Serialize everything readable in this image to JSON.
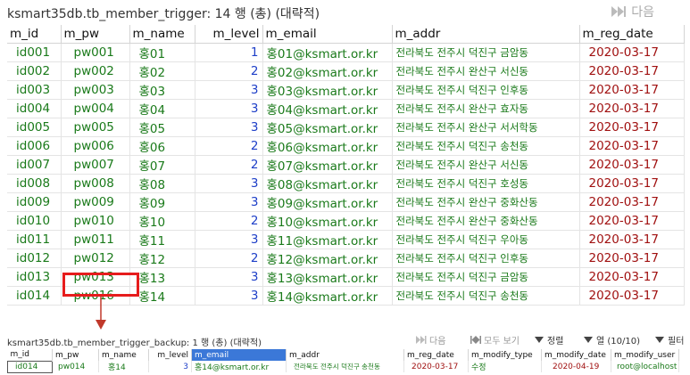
{
  "top": {
    "title": "ksmart35db.tb_member_trigger: 14 행 (총) (대략적)",
    "next_label": "다음",
    "columns": [
      "m_id",
      "m_pw",
      "m_name",
      "m_level",
      "m_email",
      "m_addr",
      "m_reg_date"
    ],
    "rows": [
      [
        "id001",
        "pw001",
        "홍01",
        "1",
        "홍01@ksmart.or.kr",
        "전라북도 전주시 덕진구 금암동",
        "2020-03-17"
      ],
      [
        "id002",
        "pw002",
        "홍02",
        "2",
        "홍02@ksmart.or.kr",
        "전라북도 전주시 완산구 서신동",
        "2020-03-17"
      ],
      [
        "id003",
        "pw003",
        "홍03",
        "3",
        "홍03@ksmart.or.kr",
        "전라북도 전주시 덕진구 인후동",
        "2020-03-17"
      ],
      [
        "id004",
        "pw004",
        "홍04",
        "3",
        "홍04@ksmart.or.kr",
        "전라북도 전주시 완산구 효자동",
        "2020-03-17"
      ],
      [
        "id005",
        "pw005",
        "홍05",
        "3",
        "홍05@ksmart.or.kr",
        "전라북도 전주시 완산구 서서학동",
        "2020-03-17"
      ],
      [
        "id006",
        "pw006",
        "홍06",
        "2",
        "홍06@ksmart.or.kr",
        "전라북도 전주시 덕진구 송천동",
        "2020-03-17"
      ],
      [
        "id007",
        "pw007",
        "홍07",
        "2",
        "홍07@ksmart.or.kr",
        "전라북도 전주시 완산구 서신동",
        "2020-03-17"
      ],
      [
        "id008",
        "pw008",
        "홍08",
        "3",
        "홍08@ksmart.or.kr",
        "전라북도 전주시 덕진구 호성동",
        "2020-03-17"
      ],
      [
        "id009",
        "pw009",
        "홍09",
        "3",
        "홍09@ksmart.or.kr",
        "전라북도 전주시 완산구 중화산동",
        "2020-03-17"
      ],
      [
        "id010",
        "pw010",
        "홍10",
        "2",
        "홍10@ksmart.or.kr",
        "전라북도 전주시 완산구 중화산동",
        "2020-03-17"
      ],
      [
        "id011",
        "pw011",
        "홍11",
        "3",
        "홍11@ksmart.or.kr",
        "전라북도 전주시 덕진구 우아동",
        "2020-03-17"
      ],
      [
        "id012",
        "pw012",
        "홍12",
        "2",
        "홍12@ksmart.or.kr",
        "전라북도 전주시 덕진구 인후동",
        "2020-03-17"
      ],
      [
        "id013",
        "pw013",
        "홍13",
        "3",
        "홍13@ksmart.or.kr",
        "전라북도 전주시 덕진구 금암동",
        "2020-03-17"
      ],
      [
        "id014",
        "pw016",
        "홍14",
        "3",
        "홍14@ksmart.or.kr",
        "전라북도 전주시 덕진구 송천동",
        "2020-03-17"
      ]
    ]
  },
  "bottom": {
    "title": "ksmart35db.tb_member_trigger_backup: 1 행 (총) (대략적)",
    "next_label": "다음",
    "show_all_label": "모두 보기",
    "sort_label": "정렬",
    "columns_label": "열 (10/10)",
    "filter_label": "필터",
    "columns": [
      "m_id",
      "m_pw",
      "m_name",
      "m_level",
      "m_email",
      "m_addr",
      "m_reg_date",
      "m_modify_type",
      "m_modify_date",
      "m_modify_user"
    ],
    "rows": [
      [
        "id014",
        "pw014",
        "홍14",
        "3",
        "홍14@ksmart.or.kr",
        "전라북도 전주시 덕진구 송천동",
        "2020-03-17",
        "수정",
        "2020-04-19",
        "root@localhost"
      ]
    ]
  },
  "colors": {
    "text_value": "#1a7a1a",
    "number_value": "#1e3fc8",
    "date_value": "#a01010",
    "annotation": "#e61c1c",
    "header_highlight": "#3b78d8"
  },
  "icons": [
    "next-icon",
    "show-all-icon",
    "sort-icon",
    "columns-icon",
    "filter-icon"
  ]
}
